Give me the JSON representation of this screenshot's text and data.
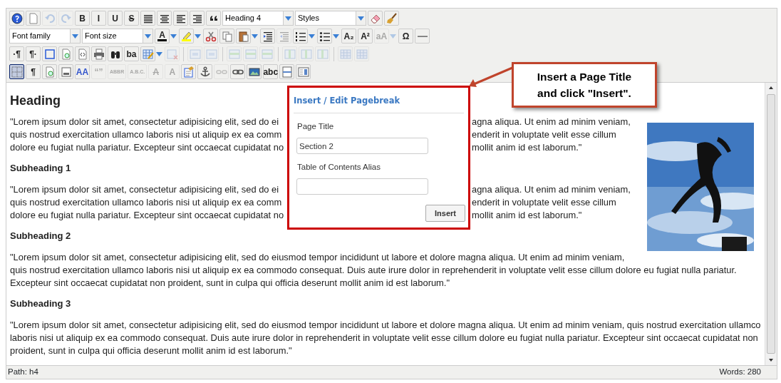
{
  "toolbars": [
    {
      "items": [
        {
          "kind": "icon",
          "disabled": false
        },
        {
          "kind": "icon",
          "disabled": false
        },
        {
          "kind": "icon",
          "disabled": true
        },
        {
          "kind": "icon",
          "disabled": true
        },
        {
          "kind": "glyph",
          "label": "B",
          "disabled": false
        },
        {
          "kind": "glyph",
          "label": "I",
          "disabled": false
        },
        {
          "kind": "glyph",
          "label": "U",
          "disabled": false
        },
        {
          "kind": "glyph",
          "label": "S",
          "strike": true,
          "disabled": false
        },
        {
          "kind": "icon",
          "disabled": false
        },
        {
          "kind": "icon",
          "disabled": false
        },
        {
          "kind": "icon",
          "disabled": false
        },
        {
          "kind": "icon",
          "disabled": false
        },
        {
          "kind": "icon",
          "disabled": false
        },
        {
          "kind": "select",
          "label": "Heading 4"
        },
        {
          "kind": "select",
          "label": "Styles"
        },
        {
          "kind": "icon",
          "disabled": false
        },
        {
          "kind": "icon",
          "disabled": false
        }
      ]
    },
    {
      "items": [
        {
          "kind": "select",
          "label": "Font family"
        },
        {
          "kind": "select",
          "label": "Font size"
        },
        {
          "kind": "color",
          "label": "A",
          "color": "#000000",
          "split": true,
          "disabled": false
        },
        {
          "kind": "color",
          "color": "#ffff00",
          "split": true,
          "disabled": false
        },
        {
          "kind": "icon",
          "disabled": false
        },
        {
          "kind": "icon",
          "disabled": false
        },
        {
          "kind": "icon",
          "split": true,
          "disabled": false
        },
        {
          "kind": "icon",
          "disabled": false
        },
        {
          "kind": "icon",
          "disabled": true
        },
        {
          "kind": "icon",
          "split": true,
          "disabled": false
        },
        {
          "kind": "icon",
          "split": true,
          "disabled": false
        },
        {
          "kind": "glyph",
          "label": "A₂",
          "disabled": false
        },
        {
          "kind": "glyph",
          "label": "A²",
          "disabled": false
        },
        {
          "kind": "glyph",
          "label": "aA",
          "split": true,
          "disabled": true
        },
        {
          "kind": "glyph",
          "label": "Ω",
          "disabled": false
        },
        {
          "kind": "icon",
          "disabled": false
        }
      ]
    },
    {
      "items": [
        {
          "kind": "glyph",
          "label": "·¶",
          "disabled": false
        },
        {
          "kind": "glyph",
          "label": "¶·",
          "disabled": false
        },
        {
          "kind": "icon",
          "disabled": false
        },
        {
          "kind": "icon",
          "disabled": false
        },
        {
          "kind": "icon",
          "disabled": false
        },
        {
          "kind": "icon",
          "disabled": false
        },
        {
          "kind": "icon",
          "disabled": false
        },
        {
          "kind": "glyph",
          "label": "ba",
          "disabled": false
        },
        {
          "kind": "icon",
          "split": true,
          "disabled": false
        },
        {
          "kind": "icon",
          "disabled": true
        },
        {
          "kind": "separator"
        },
        {
          "kind": "icon",
          "disabled": true
        },
        {
          "kind": "icon",
          "disabled": true
        },
        {
          "kind": "separator"
        },
        {
          "kind": "icon",
          "disabled": true
        },
        {
          "kind": "icon",
          "disabled": true
        },
        {
          "kind": "icon",
          "disabled": true
        },
        {
          "kind": "separator"
        },
        {
          "kind": "icon",
          "disabled": true
        },
        {
          "kind": "icon",
          "disabled": true
        },
        {
          "kind": "icon",
          "disabled": true
        },
        {
          "kind": "separator"
        },
        {
          "kind": "icon",
          "disabled": true
        },
        {
          "kind": "icon",
          "disabled": true
        }
      ]
    },
    {
      "items": [
        {
          "kind": "icon",
          "selected": true,
          "disabled": false
        },
        {
          "kind": "glyph",
          "label": "¶",
          "disabled": false
        },
        {
          "kind": "icon",
          "disabled": false
        },
        {
          "kind": "icon",
          "disabled": false
        },
        {
          "kind": "glyph",
          "label": "AA",
          "color": "#3355cc",
          "disabled": false
        },
        {
          "kind": "glyph",
          "label": "“”",
          "disabled": true
        },
        {
          "kind": "glyph",
          "label": "ABBR",
          "disabled": true
        },
        {
          "kind": "glyph",
          "label": "A.B.C.",
          "disabled": true
        },
        {
          "kind": "glyph",
          "label": "A",
          "strike": true,
          "disabled": true
        },
        {
          "kind": "glyph",
          "label": "A",
          "disabled": true
        },
        {
          "kind": "icon",
          "disabled": false
        },
        {
          "kind": "icon",
          "disabled": false
        },
        {
          "kind": "icon",
          "disabled": true
        },
        {
          "kind": "icon",
          "disabled": false
        },
        {
          "kind": "icon",
          "disabled": false
        },
        {
          "kind": "glyph",
          "label": "abc",
          "disabled": false
        },
        {
          "kind": "icon",
          "disabled": false
        },
        {
          "kind": "icon",
          "disabled": false
        }
      ]
    }
  ],
  "content": [
    {
      "kind": "heading",
      "text": "Heading"
    },
    {
      "kind": "picture"
    },
    {
      "kind": "paragraph",
      "lines": [
        [
          "\"Lorem ipsum dolor sit amet, consectetur adipisicing elit, sed do ei",
          "agna aliqua. Ut enim ad minim veniam,"
        ],
        [
          "quis nostrud exercitation ullamco laboris nisi ut aliquip ex ea comm",
          "enderit in voluptate velit esse cillum"
        ],
        [
          "dolore eu fugiat nulla pariatur. Excepteur sint occaecat cupidatat no",
          "mollit anim id est laborum.\""
        ]
      ]
    },
    {
      "kind": "subheading",
      "text": "Subheading 1"
    },
    {
      "kind": "paragraph",
      "lines": [
        [
          "\"Lorem ipsum dolor sit amet, consectetur adipisicing elit, sed do ei",
          "agna aliqua. Ut enim ad minim veniam,"
        ],
        [
          "quis nostrud exercitation ullamco laboris nisi ut aliquip ex ea comm",
          "enderit in voluptate velit esse cillum"
        ],
        [
          "dolore eu fugiat nulla pariatur. Excepteur sint occaecat cupidatat no",
          "mollit anim id est laborum.\""
        ]
      ]
    },
    {
      "kind": "subheading",
      "text": "Subheading 2"
    },
    {
      "kind": "paragraph",
      "text": "\"Lorem ipsum dolor sit amet, consectetur adipisicing elit, sed do eiusmod tempor incididunt ut labore et dolore magna aliqua. Ut enim ad minim veniam, quis nostrud exercitation ullamco laboris nisi ut aliquip ex ea commodo consequat. Duis aute irure dolor in reprehenderit in voluptate velit esse cillum dolore eu fugiat nulla pariatur. Excepteur sint occaecat cupidatat non proident, sunt in culpa qui officia deserunt mollit anim id est laborum.\""
    },
    {
      "kind": "subheading",
      "text": "Subheading 3"
    },
    {
      "kind": "paragraph",
      "text": "\"Lorem ipsum dolor sit amet, consectetur adipisicing elit, sed do eiusmod tempor incididunt ut labore et dolore magna aliqua. Ut enim ad minim veniam, quis nostrud exercitation ullamco laboris nisi ut aliquip ex ea commodo consequat. Duis aute irure dolor in reprehenderit in voluptate velit esse cillum dolore eu fugiat nulla pariatur. Excepteur sint occaecat cupidatat non proident, sunt in culpa qui officia deserunt mollit anim id est laborum.\""
    }
  ],
  "dialog": {
    "title": "Insert / Edit Pagebreak",
    "fields": [
      {
        "label": "Page Title",
        "value": "Section 2"
      },
      {
        "label": "Table of Contents Alias"
      }
    ],
    "button": "Insert"
  },
  "callout": {
    "lines": [
      "Insert a Page Title",
      "and click \"Insert\"."
    ]
  },
  "status_bar": {
    "path_label": "Path:",
    "path": "h4",
    "words": "Words: 280"
  }
}
